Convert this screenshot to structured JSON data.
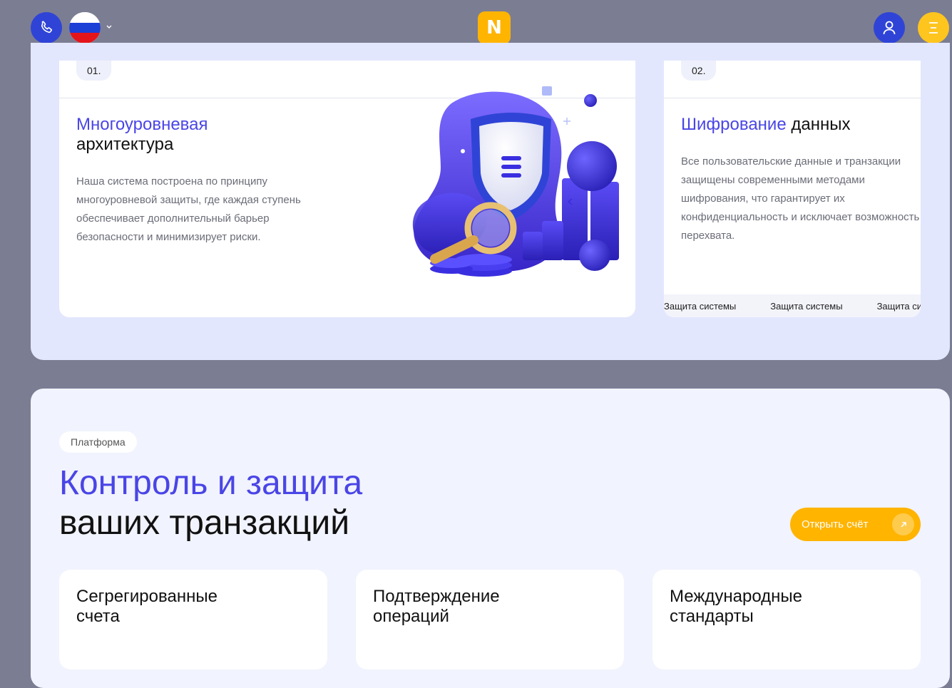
{
  "header": {
    "phone_icon": "phone-icon",
    "language_flag": "russia-flag",
    "logo_letter": "N",
    "colors": {
      "blue": "#2f44d6",
      "yellow": "#ffb400"
    }
  },
  "features": {
    "card1": {
      "number": "01.",
      "title_accent": "Многоуровневая",
      "title_rest": "архитектура",
      "text_lines": [
        "Наша система построена по принципу",
        "многоуровневой защиты, где каждая ступень",
        "обеспечивает дополнительный барьер",
        "безопасности и минимизирует риски."
      ]
    },
    "card2": {
      "number": "02.",
      "title_accent": "Шифрование",
      "title_rest": "данных",
      "text_lines": [
        "Все пользовательские данные и транзакции",
        "защищены современными методами",
        "шифрования, что гарантирует их",
        "конфиденциальность и исключает возможность",
        "перехвата."
      ],
      "marquee": [
        "Защита системы",
        "Защита системы",
        "Защита системы"
      ]
    }
  },
  "platform": {
    "badge": "Платформа",
    "title_line1": "Контроль и защита",
    "title_line2": "ваших транзакций",
    "cta_label": "Открыть счёт",
    "cards": [
      {
        "title_line1": "Сегрегированные",
        "title_line2": "счета"
      },
      {
        "title_line1": "Подтверждение",
        "title_line2": "операций"
      },
      {
        "title_line1": "Международные",
        "title_line2": "стандарты"
      }
    ]
  }
}
